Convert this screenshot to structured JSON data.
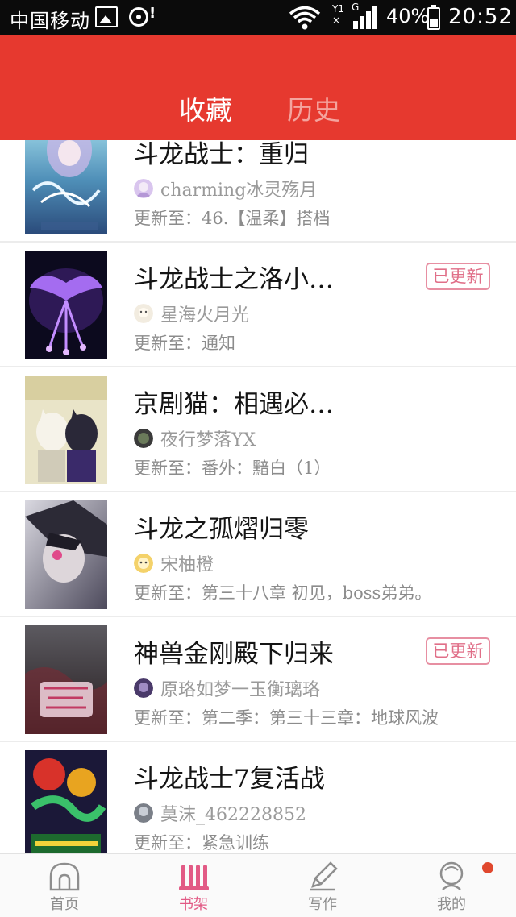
{
  "status_bar": {
    "carrier": "中国移动",
    "battery_percent": "40%",
    "battery_level": 0.4,
    "time": "20:52",
    "network_top": "Y1",
    "network_type": "G",
    "icons": [
      "image-icon",
      "media-icon",
      "wifi-icon",
      "signal-icon",
      "battery-icon"
    ]
  },
  "header": {
    "tabs": [
      {
        "label": "收藏",
        "active": true
      },
      {
        "label": "历史",
        "active": false
      }
    ],
    "background_color": "#e6392f"
  },
  "books": [
    {
      "title": "斗龙战士：重归",
      "author": "charming冰灵殇月",
      "update": "更新至：46.【温柔】搭档",
      "badge": ""
    },
    {
      "title": "斗龙战士之洛小…",
      "author": "星海火月光",
      "update": "更新至：通知",
      "badge": "已更新"
    },
    {
      "title": "京剧猫：相遇必…",
      "author": "夜行梦落YX",
      "update": "更新至：番外：黯白（1）",
      "badge": ""
    },
    {
      "title": "斗龙之孤熠归零",
      "author": "宋柚橙",
      "update": "更新至：第三十八章 初见，boss弟弟。",
      "badge": ""
    },
    {
      "title": "神兽金刚殿下归来",
      "author": "原珞如梦一玉衡璃珞",
      "update": "更新至：第二季：第三十三章：地球风波",
      "badge": "已更新"
    },
    {
      "title": "斗龙战士7复活战",
      "author": "莫沫_462228852",
      "update": "更新至：紧急训练",
      "badge": ""
    }
  ],
  "bottom_nav": [
    {
      "label": "首页",
      "icon": "home-icon",
      "active": false
    },
    {
      "label": "书架",
      "icon": "bookshelf-icon",
      "active": true
    },
    {
      "label": "写作",
      "icon": "pen-icon",
      "active": false
    },
    {
      "label": "我的",
      "icon": "profile-icon",
      "active": false
    }
  ],
  "colors": {
    "accent": "#e6392f",
    "nav_active": "#e25a85",
    "badge": "#e06f88",
    "notification_dot": "#e0482e"
  }
}
